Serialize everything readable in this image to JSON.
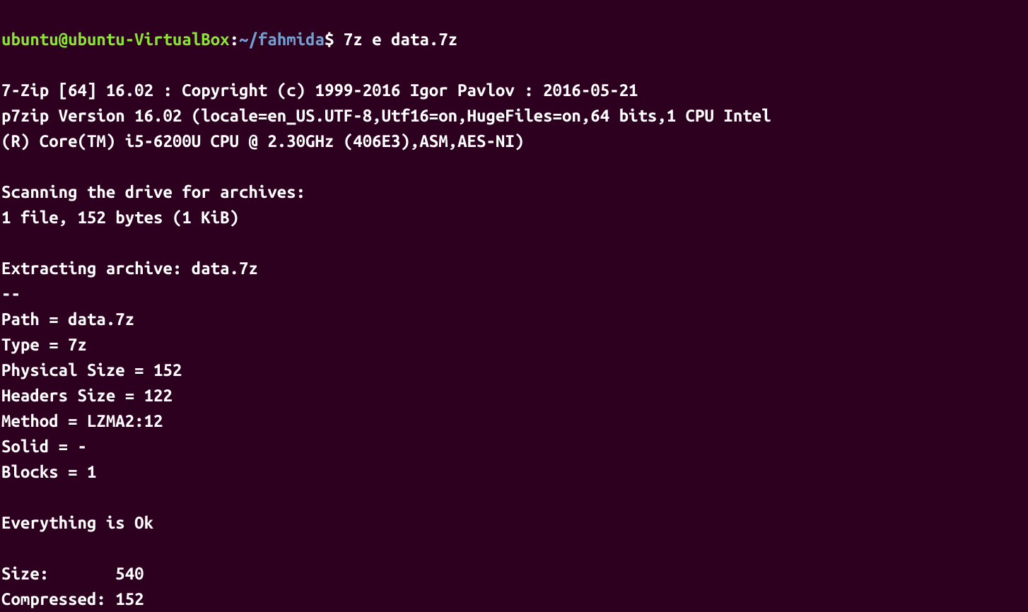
{
  "prompt": {
    "user": "ubuntu",
    "at": "@",
    "host": "ubuntu-VirtualBox",
    "colon": ":",
    "tilde": "~",
    "slash": "/",
    "dir": "fahmida",
    "dollar": "$ "
  },
  "command": "7z e data.7z",
  "output": {
    "blank1": "",
    "line1": "7-Zip [64] 16.02 : Copyright (c) 1999-2016 Igor Pavlov : 2016-05-21",
    "line2": "p7zip Version 16.02 (locale=en_US.UTF-8,Utf16=on,HugeFiles=on,64 bits,1 CPU Intel",
    "line3": "(R) Core(TM) i5-6200U CPU @ 2.30GHz (406E3),ASM,AES-NI)",
    "blank2": "",
    "line4": "Scanning the drive for archives:",
    "line5": "1 file, 152 bytes (1 KiB)",
    "blank3": "",
    "line6": "Extracting archive: data.7z",
    "line7": "--",
    "line8": "Path = data.7z",
    "line9": "Type = 7z",
    "line10": "Physical Size = 152",
    "line11": "Headers Size = 122",
    "line12": "Method = LZMA2:12",
    "line13": "Solid = -",
    "line14": "Blocks = 1",
    "blank4": "",
    "line15": "Everything is Ok",
    "blank5": "",
    "line16": "Size:       540",
    "line17": "Compressed: 152"
  }
}
